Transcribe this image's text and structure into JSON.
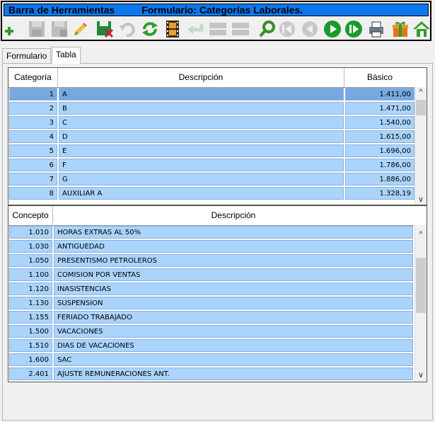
{
  "toolbar": {
    "title": "Barra de Herramientas",
    "form_title": "Formulario: Categorías Laborales."
  },
  "tabs": [
    {
      "label": "Formulario"
    },
    {
      "label": "Tabla"
    }
  ],
  "categories_table": {
    "headers": {
      "category": "Categoría",
      "description": "Descripción",
      "basic": "Básico"
    },
    "rows": [
      {
        "category": "1",
        "description": "A",
        "basic": "1.411,00"
      },
      {
        "category": "2",
        "description": "B",
        "basic": "1.471,00"
      },
      {
        "category": "3",
        "description": "C",
        "basic": "1.540,00"
      },
      {
        "category": "4",
        "description": "D",
        "basic": "1.615,00"
      },
      {
        "category": "5",
        "description": "E",
        "basic": "1.696,00"
      },
      {
        "category": "6",
        "description": "F",
        "basic": "1.786,00"
      },
      {
        "category": "7",
        "description": "G",
        "basic": "1.886,00"
      },
      {
        "category": "8",
        "description": "AUXILIAR A",
        "basic": "1.328,19"
      }
    ]
  },
  "concepts_table": {
    "headers": {
      "concept": "Concepto",
      "description": "Descripción"
    },
    "rows": [
      {
        "concept": "1.010",
        "description": "HORAS EXTRAS AL 50%"
      },
      {
        "concept": "1.030",
        "description": "ANTIGUEDAD"
      },
      {
        "concept": "1.050",
        "description": "PRESENTISMO PETROLEROS"
      },
      {
        "concept": "1.100",
        "description": "COMISION POR VENTAS"
      },
      {
        "concept": "1.120",
        "description": "INASISTENCIAS"
      },
      {
        "concept": "1.130",
        "description": "SUSPENSION"
      },
      {
        "concept": "1.155",
        "description": "FERIADO TRABAJADO"
      },
      {
        "concept": "1.500",
        "description": "VACACIONES"
      },
      {
        "concept": "1.510",
        "description": "DIAS DE VACACIONES"
      },
      {
        "concept": "1.600",
        "description": "SAC"
      },
      {
        "concept": "2.401",
        "description": "AJUSTE REMUNERACIONES ANT."
      }
    ]
  },
  "colors": {
    "title_bar": "#0b78ee",
    "row_fill": "#aad4fb",
    "selected_row": "#77a9e0"
  }
}
